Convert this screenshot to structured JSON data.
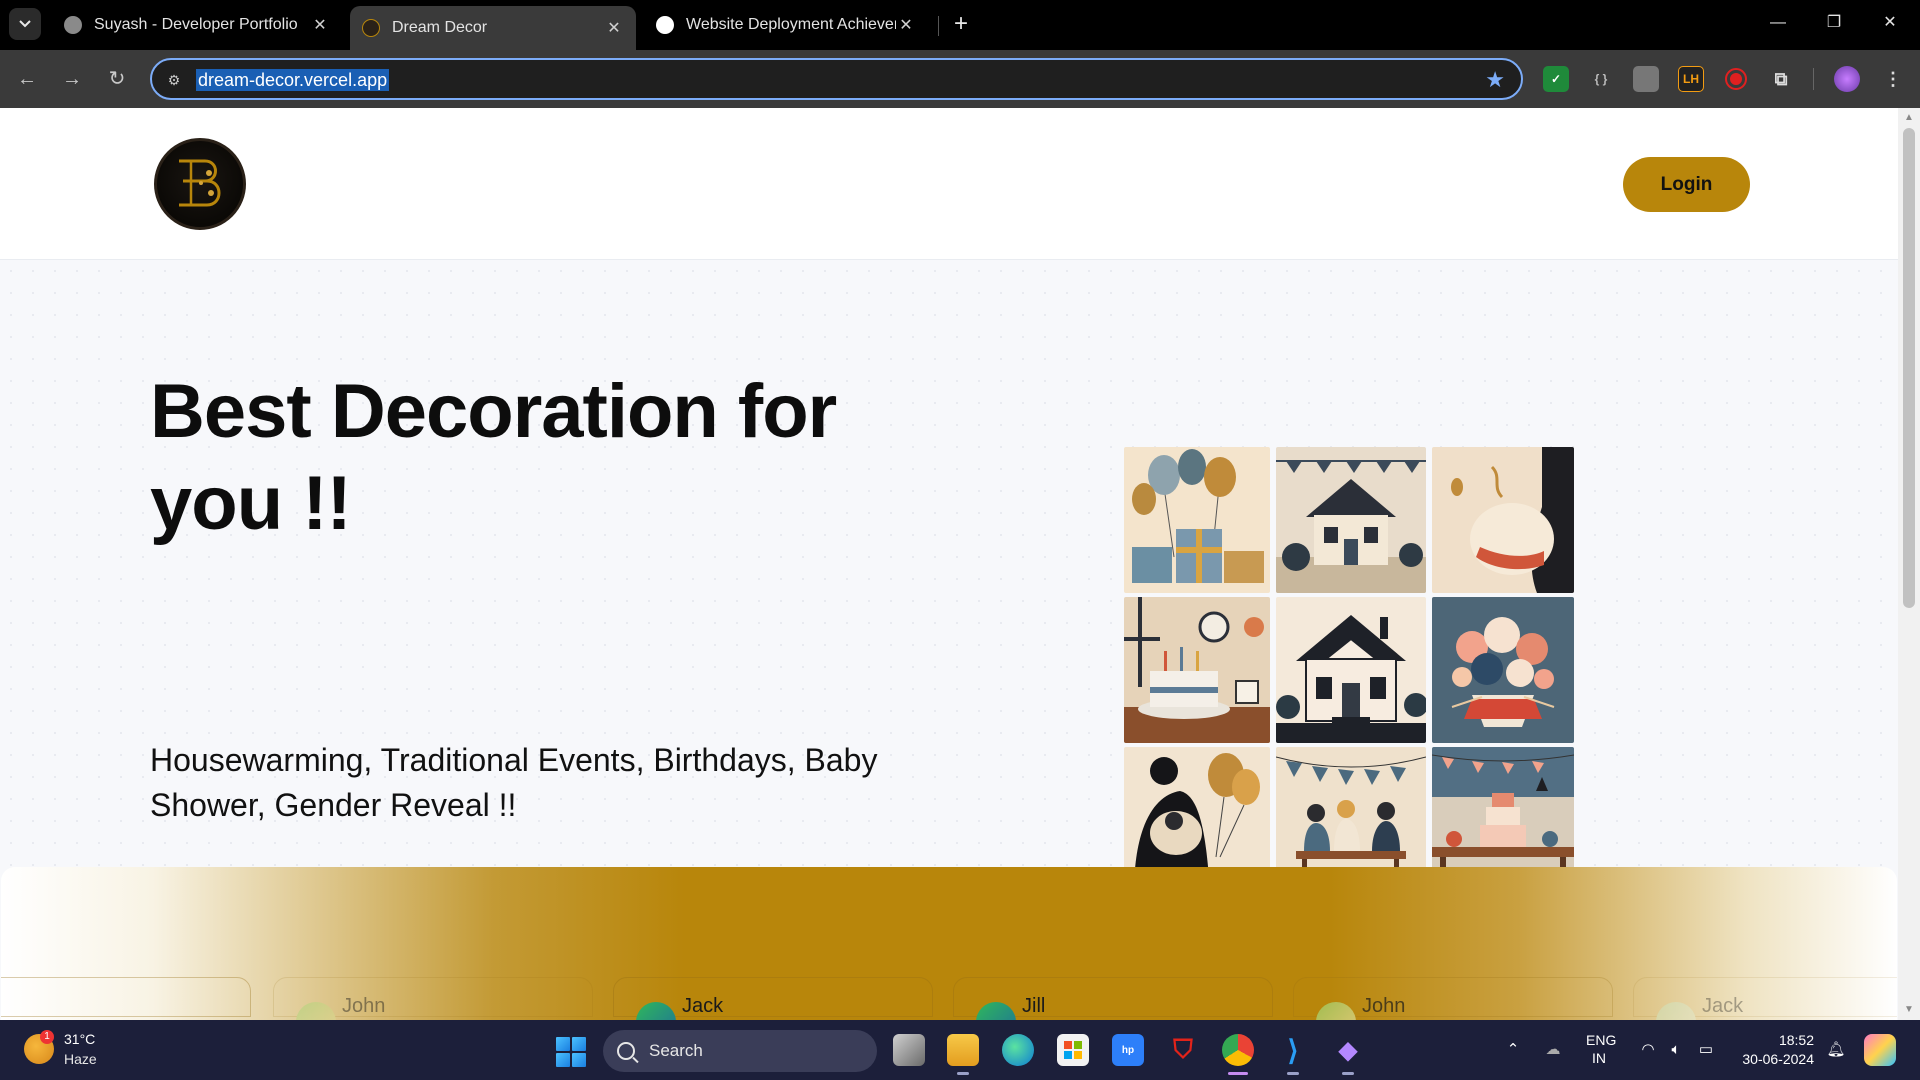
{
  "browser": {
    "tabs": [
      {
        "title": "Suyash - Developer Portfolio",
        "active": false
      },
      {
        "title": "Dream Decor",
        "active": true
      },
      {
        "title": "Website Deployment Achievem",
        "active": false
      }
    ],
    "url": "dream-decor.vercel.app",
    "accent_color": "#7cacf8"
  },
  "site": {
    "logo_letter": "B",
    "login_label": "Login",
    "hero_title": "Best Decoration for you !!",
    "hero_subtitle": "Housewarming, Traditional Events, Birthdays, Baby Shower, Gender Reveal !!",
    "brand_color": "#b8860b",
    "collage_tiles": [
      "balloons-gifts-icon",
      "house-icon",
      "pregnancy-icon",
      "birthday-cake-icon",
      "house-icon",
      "flower-bouquet-icon",
      "father-baby-icon",
      "celebration-party-icon",
      "cake-table-icon"
    ],
    "testimonials": [
      {
        "name": "John"
      },
      {
        "name": "Jack"
      },
      {
        "name": "Jill"
      },
      {
        "name": "John"
      },
      {
        "name": "Jack"
      }
    ]
  },
  "taskbar": {
    "weather_temp": "31°C",
    "weather_desc": "Haze",
    "weather_badge": "1",
    "search_label": "Search",
    "lang_top": "ENG",
    "lang_bottom": "IN",
    "time": "18:52",
    "date": "30-06-2024"
  }
}
